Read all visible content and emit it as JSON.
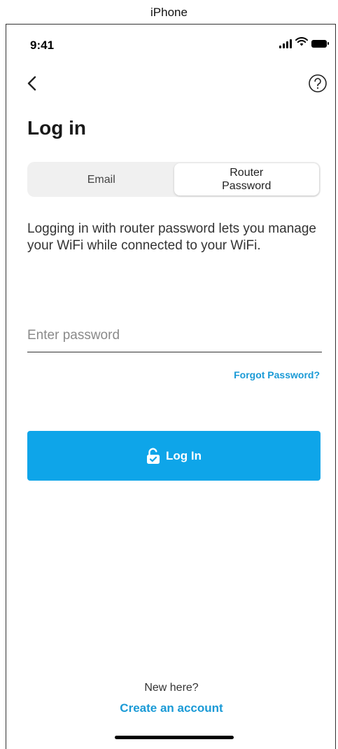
{
  "device_label": "iPhone",
  "status_bar": {
    "time": "9:41",
    "icons": [
      "signal-icon",
      "wifi-icon",
      "battery-icon"
    ]
  },
  "nav": {
    "back_icon": "chevron-left-icon",
    "help_icon": "question-circle-icon"
  },
  "title": "Log in",
  "tabs": [
    {
      "label": "Email",
      "selected": false
    },
    {
      "label": "Router Password",
      "selected": true
    }
  ],
  "description": "Logging in with router password lets you manage your WiFi while connected to your WiFi.",
  "password": {
    "placeholder": "Enter password",
    "value": ""
  },
  "forgot_password_label": "Forgot Password?",
  "login_button": {
    "label": "Log In",
    "icon": "unlock-icon"
  },
  "footer": {
    "prompt": "New here?",
    "create_account_label": "Create an account"
  },
  "colors": {
    "accent": "#0ea5e9",
    "link": "#1a9ad6",
    "segment_bg": "#f0f0f0"
  }
}
